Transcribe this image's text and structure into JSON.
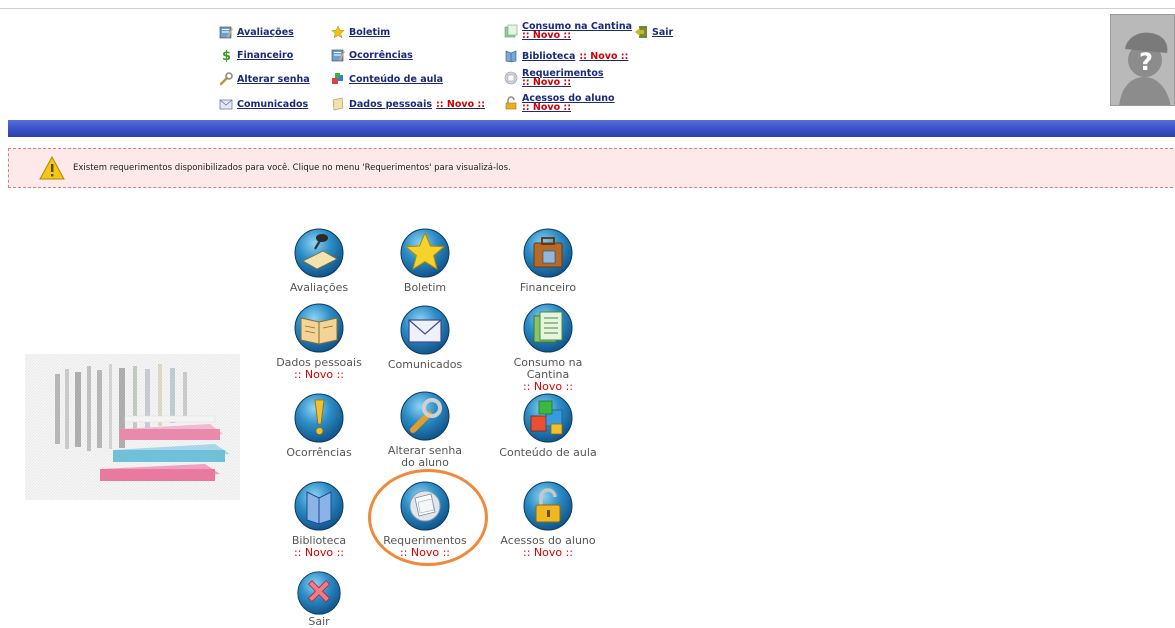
{
  "top_menu": {
    "avaliacoes": "Avaliações",
    "boletim": "Boletim",
    "consumo": "Consumo na Cantina",
    "consumo_novo": ":: Novo ::",
    "sair": "Sair",
    "financeiro": "Financeiro",
    "ocorrencias": "Ocorrências",
    "biblioteca": "Biblioteca",
    "biblioteca_novo": ":: Novo ::",
    "alterar_senha": "Alterar senha",
    "conteudo": "Conteúdo de aula",
    "requerimentos": "Requerimentos",
    "requerimentos_novo": ":: Novo ::",
    "comunicados": "Comunicados",
    "dados_pessoais": "Dados pessoais",
    "dados_pessoais_novo": ":: Novo ::",
    "acessos": "Acessos do aluno",
    "acessos_novo": ":: Novo ::"
  },
  "alert": {
    "message": "Existem requerimentos disponibilizados para você. Clique no menu 'Requerimentos' para visualizá-los."
  },
  "tiles": {
    "avaliacoes": "Avaliações",
    "boletim": "Boletim",
    "financeiro": "Financeiro",
    "dados_pessoais": "Dados pessoais",
    "dados_pessoais_novo": ":: Novo ::",
    "comunicados": "Comunicados",
    "consumo": "Consumo na Cantina",
    "consumo_novo": ":: Novo ::",
    "ocorrencias": "Ocorrências",
    "alterar_senha_1": "Alterar senha",
    "alterar_senha_2": "do aluno",
    "conteudo": "Conteúdo de aula",
    "biblioteca": "Biblioteca",
    "biblioteca_novo": ":: Novo ::",
    "requerimentos": "Requerimentos",
    "requerimentos_novo": ":: Novo ::",
    "acessos": "Acessos do aluno",
    "acessos_novo": ":: Novo ::",
    "sair": "Sair"
  },
  "colors": {
    "menu_link": "#1a2a7a",
    "novo": "#d40000",
    "blue_bar": "#3d55c8",
    "alert_bg": "#fde9e9",
    "highlight": "#f08a3a"
  }
}
